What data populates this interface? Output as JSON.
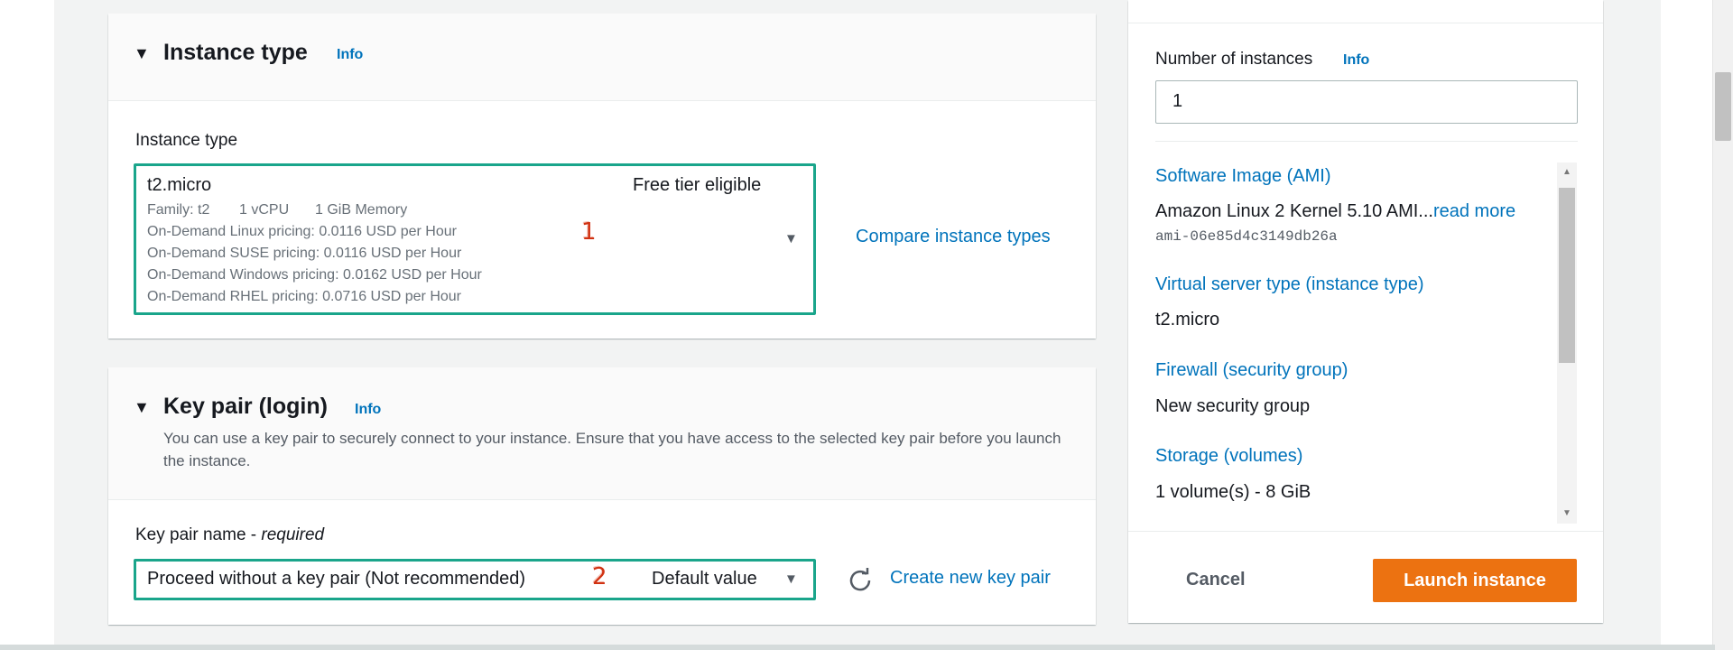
{
  "instance_type_section": {
    "title": "Instance type",
    "info": "Info",
    "field_label": "Instance type",
    "selected": {
      "name": "t2.micro",
      "tier": "Free tier eligible",
      "family": "Family: t2",
      "vcpu": "1 vCPU",
      "memory": "1 GiB Memory",
      "pricing": [
        "On-Demand Linux pricing: 0.0116 USD per Hour",
        "On-Demand SUSE pricing: 0.0116 USD per Hour",
        "On-Demand Windows pricing: 0.0162 USD per Hour",
        "On-Demand RHEL pricing: 0.0716 USD per Hour"
      ]
    },
    "annotation": "1",
    "compare_link": "Compare instance types"
  },
  "key_pair_section": {
    "title": "Key pair (login)",
    "info": "Info",
    "description": "You can use a key pair to securely connect to your instance. Ensure that you have access to the selected key pair before you launch the instance.",
    "field_label": "Key pair name - ",
    "field_required": "required",
    "selected": "Proceed without a key pair (Not recommended)",
    "selected_tag": "Default value",
    "annotation": "2",
    "create_link": "Create new key pair"
  },
  "summary": {
    "num_instances_label": "Number of instances",
    "num_instances_info": "Info",
    "num_instances_value": "1",
    "ami_label": "Software Image (AMI)",
    "ami_value": "Amazon Linux 2 Kernel 5.10 AMI...",
    "ami_read_more": "read more",
    "ami_id": "ami-06e85d4c3149db26a",
    "instance_type_label": "Virtual server type (instance type)",
    "instance_type_value": "t2.micro",
    "firewall_label": "Firewall (security group)",
    "firewall_value": "New security group",
    "storage_label": "Storage (volumes)",
    "storage_value": "1 volume(s) - 8 GiB",
    "cancel": "Cancel",
    "launch": "Launch instance"
  },
  "colors": {
    "accent_link": "#0073bb",
    "highlight_border": "#1aa58b",
    "annotation": "#d13212",
    "primary_button": "#ec7211"
  }
}
